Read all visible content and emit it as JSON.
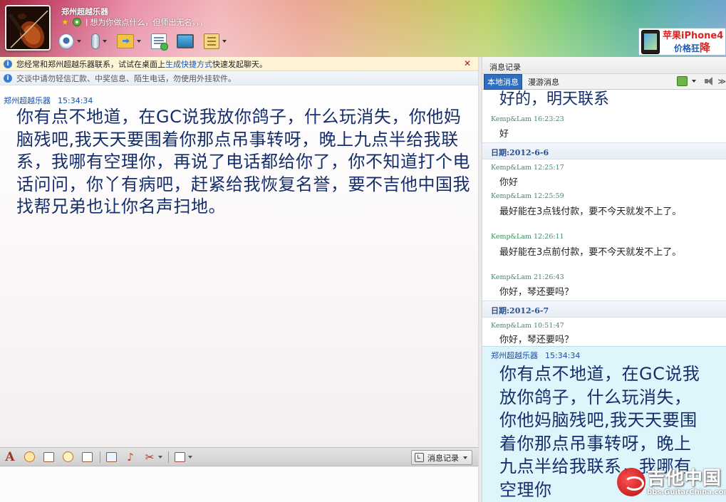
{
  "header": {
    "contact_name": "郑州超越乐器",
    "signature_sep": "|",
    "signature": "想为你做点什么，但师出无名，，，",
    "toolbar": [
      {
        "name": "webcam-icon"
      },
      {
        "name": "microphone-icon"
      },
      {
        "name": "send-file-icon"
      },
      {
        "name": "group-chat-icon"
      },
      {
        "name": "remote-desktop-icon"
      },
      {
        "name": "apps-icon"
      }
    ],
    "ad": {
      "line1": "苹果iPhone4",
      "line2_prefix": "价格狂",
      "line2_emph": "降"
    }
  },
  "notices": {
    "first_prefix": "您经常和郑州超越乐器联系，试试在桌面上",
    "first_link": "生成快捷方式",
    "first_suffix": "快速发起聊天。",
    "second": "交谈中请勿轻信汇款、中奖信息、陌生电话，勿使用外挂软件。"
  },
  "chat": {
    "sender": "郑州超越乐器",
    "time": "15:34:34",
    "message": "你有点不地道，在GC说我放你鸽子，什么玩消失，你他妈脑残吧,我天天要围着你那点吊事转呀，晚上九点半给我联系，我哪有空理你，再说了电话都给你了，你不知道打个电话问问，你丫有病吧，赶紧给我恢复名誉，要不吉他中国我找帮兄弟也让你名声扫地。"
  },
  "input_toolbar": {
    "font_label": "A",
    "history_label": "消息记录"
  },
  "history": {
    "title": "消息记录",
    "tabs": [
      "本地消息",
      "漫游消息"
    ],
    "partial_top": "好的，明天联系",
    "items": [
      {
        "meta": "Kemp&Lam 16:23:23",
        "text": "好"
      },
      {
        "date": "日期:2012-6-6"
      },
      {
        "meta": "Kemp&Lam 12:25:17",
        "text": "你好"
      },
      {
        "meta": "Kemp&Lam 12:25:59",
        "text": "最好能在3点钱付款，要不今天就发不上了。"
      },
      {
        "meta": "Kemp&Lam 12:26:11",
        "text": "最好能在3点前付款，要不今天就发不上了。"
      },
      {
        "meta": "Kemp&Lam 21:26:43",
        "text": "你好，琴还要吗？"
      },
      {
        "date": "日期:2012-6-7"
      },
      {
        "meta": "Kemp&Lam 10:51:47",
        "text": "你好，琴还要吗？"
      }
    ],
    "current": {
      "sender": "郑州超越乐器",
      "time": "15:34:34",
      "message": "你有点不地道，在GC说我放你鸽子，什么玩消失，你他妈脑残吧,我天天要围着你那点吊事转呀，晚上九点半给我联系，我哪有空理你"
    },
    "more": "≫"
  },
  "watermark": {
    "title": "吉他中国",
    "url": "bbs.GuitarChina.com"
  }
}
